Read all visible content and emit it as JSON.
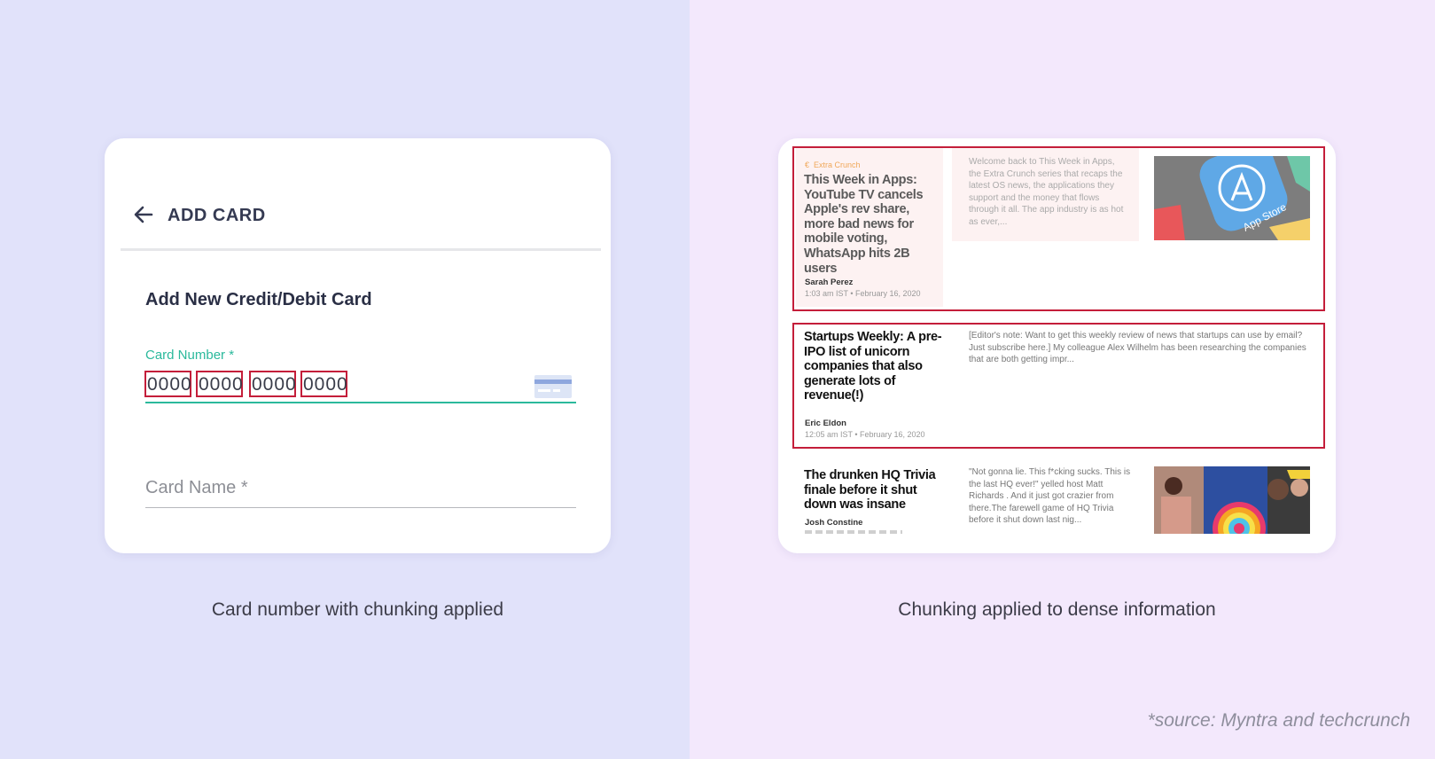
{
  "left": {
    "header": {
      "title": "ADD CARD",
      "back_icon": "arrow-left-icon"
    },
    "section_title": "Add New Credit/Debit Card",
    "card_number": {
      "label": "Card Number *",
      "chunks": [
        "0000",
        "0000",
        "0000",
        "0000"
      ],
      "card_icon": "credit-card-icon"
    },
    "card_name": {
      "placeholder": "Card Name *"
    },
    "caption": "Card number with chunking applied",
    "colors": {
      "accent": "#2bb99c",
      "chunk_border": "#c41e3a",
      "text": "#353a52"
    }
  },
  "right": {
    "articles": [
      {
        "tag": "Extra Crunch",
        "title": "This Week in Apps: YouTube TV cancels Apple's rev share, more bad news for mobile voting, WhatsApp hits 2B users",
        "author": "Sarah Perez",
        "meta": "1:03 am IST  •  February 16, 2020",
        "excerpt": "Welcome back to This Week in Apps, the Extra Crunch series that recaps the latest OS news, the applications they support and the money that flows through it all. The app industry is as hot as ever,...",
        "thumb_text": "App Store"
      },
      {
        "title": "Startups Weekly: A pre-IPO list of unicorn companies that also generate lots of revenue(!)",
        "author": "Eric Eldon",
        "meta": "12:05 am IST  •  February 16, 2020",
        "excerpt": "[Editor's note: Want to get this weekly review of news that startups can use by email? Just subscribe here.]  My colleague Alex Wilhelm has been researching the companies that are both getting impr..."
      },
      {
        "title": "The drunken HQ Trivia finale before it shut down was insane",
        "author": "Josh Constine",
        "excerpt": "\"Not gonna lie. This f*cking sucks. This is the last HQ ever!\" yelled host Matt Richards . And it just got crazier from there.The farewell game of HQ Trivia before it shut down last nig..."
      }
    ],
    "caption": "Chunking applied to dense information"
  },
  "source_note": "*source: Myntra and techcrunch"
}
